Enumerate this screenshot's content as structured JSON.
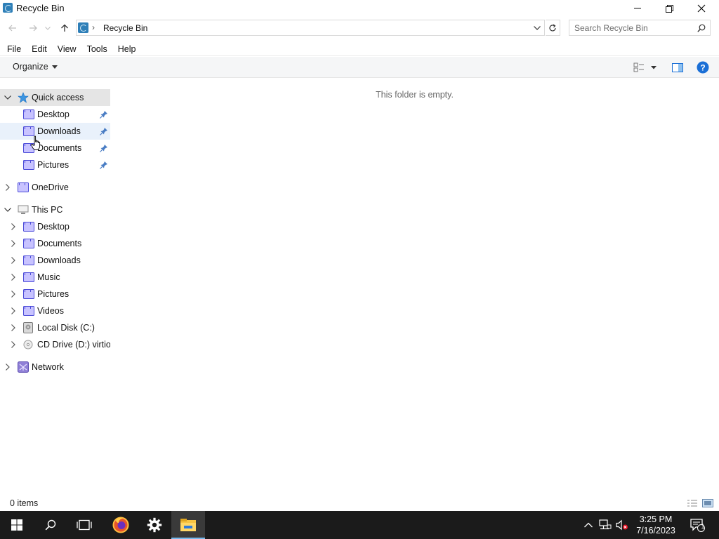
{
  "window": {
    "title": "Recycle Bin"
  },
  "address": {
    "location": "Recycle Bin",
    "separator": "›"
  },
  "search": {
    "placeholder": "Search Recycle Bin"
  },
  "menu": {
    "items": [
      "File",
      "Edit",
      "View",
      "Tools",
      "Help"
    ]
  },
  "toolbar": {
    "organize_label": "Organize"
  },
  "navpane": {
    "quick_access": {
      "label": "Quick access",
      "items": [
        "Desktop",
        "Downloads",
        "Documents",
        "Pictures"
      ]
    },
    "onedrive": {
      "label": "OneDrive"
    },
    "this_pc": {
      "label": "This PC",
      "items": [
        "Desktop",
        "Documents",
        "Downloads",
        "Music",
        "Pictures",
        "Videos",
        "Local Disk (C:)",
        "CD Drive (D:) virtio"
      ]
    },
    "network": {
      "label": "Network"
    }
  },
  "content": {
    "empty_message": "This folder is empty."
  },
  "status": {
    "item_count": "0 items"
  },
  "taskbar": {
    "time": "3:25 PM",
    "date": "7/16/2023",
    "notification_count": "1"
  },
  "colors": {
    "accent": "#0078d7",
    "help_icon": "#1a6fd6",
    "folder_fill": "#c8c3ff",
    "folder_stroke": "#4b4bd8",
    "taskbar": "#1b1b1b"
  }
}
